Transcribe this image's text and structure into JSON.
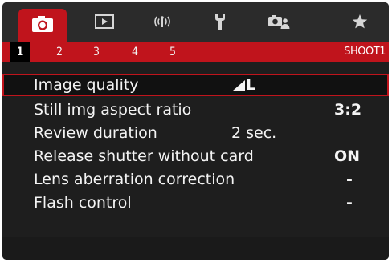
{
  "tabs": [
    {
      "id": "shoot",
      "icon": "camera-icon",
      "active": true
    },
    {
      "id": "playback",
      "icon": "play-icon",
      "active": false
    },
    {
      "id": "wireless",
      "icon": "wireless-icon",
      "active": false
    },
    {
      "id": "setup",
      "icon": "wrench-icon",
      "active": false
    },
    {
      "id": "custom",
      "icon": "camera-person-icon",
      "active": false
    },
    {
      "id": "mymenu",
      "icon": "star-icon",
      "active": false
    }
  ],
  "subtabs": [
    "1",
    "2",
    "3",
    "4",
    "5"
  ],
  "active_subtab": "1",
  "section_title": "SHOOT1",
  "menu": {
    "items": [
      {
        "label": "Image quality",
        "value": "L",
        "value_icon": "quality-fine-icon",
        "selected": true
      },
      {
        "label": "Still img aspect ratio",
        "value": "3:2"
      },
      {
        "label": "Review duration",
        "value": "2 sec."
      },
      {
        "label": "Release shutter without card",
        "value": "ON"
      },
      {
        "label": "Lens aberration correction",
        "value": "-"
      },
      {
        "label": "Flash control",
        "value": "-"
      }
    ]
  },
  "colors": {
    "accent": "#c0141c",
    "background": "#1e1e1e",
    "text": "#f4f4f4"
  }
}
